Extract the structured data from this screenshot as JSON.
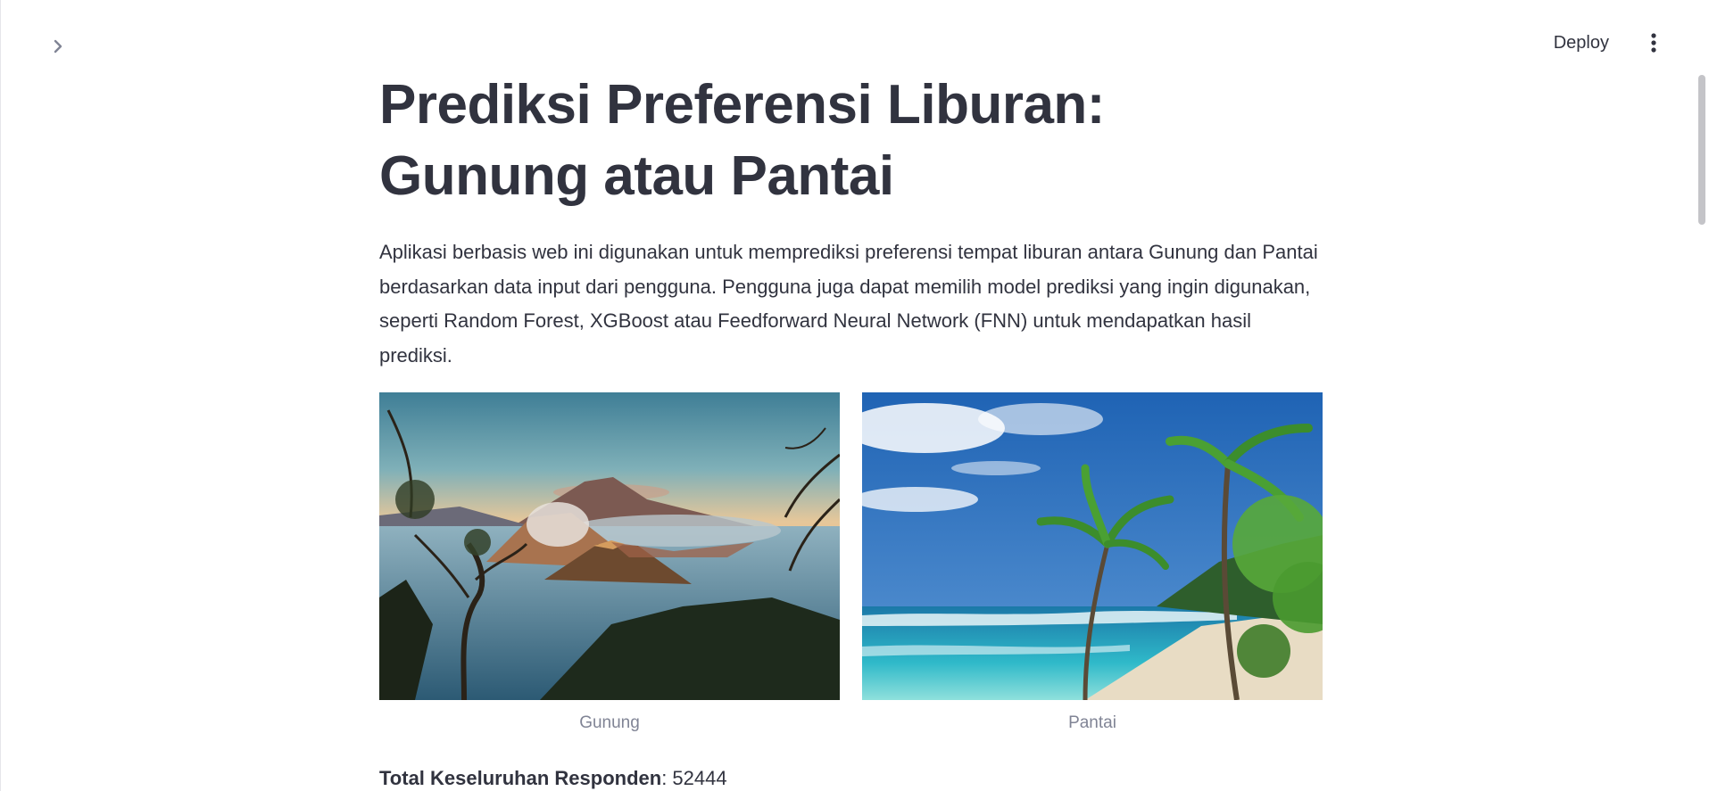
{
  "header": {
    "deploy_label": "Deploy",
    "sidebar_toggle_icon": "chevron-right-icon",
    "menu_icon": "vertical-ellipsis-icon"
  },
  "main": {
    "title": "Prediksi Preferensi Liburan: Gunung atau Pantai",
    "description": "Aplikasi berbasis web ini digunakan untuk memprediksi preferensi tempat liburan antara Gunung dan Pantai berdasarkan data input dari pengguna. Pengguna juga dapat memilih model prediksi yang ingin digunakan, seperti Random Forest, XGBoost atau Feedforward Neural Network (FNN) untuk mendapatkan hasil prediksi.",
    "images": [
      {
        "caption": "Gunung",
        "icon": "mountain-photo"
      },
      {
        "caption": "Pantai",
        "icon": "beach-photo"
      }
    ],
    "stats": {
      "label": "Total Keseluruhan Responden",
      "separator": ": ",
      "value": "52444"
    }
  },
  "colors": {
    "text": "#31333f",
    "caption": "#808495",
    "background": "#ffffff"
  }
}
